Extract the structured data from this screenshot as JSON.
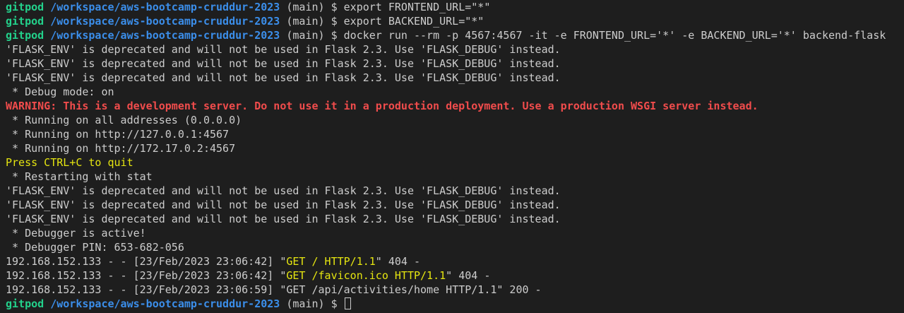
{
  "prompt": {
    "user": "gitpod",
    "path": "/workspace/aws-bootcamp-cruddur-2023",
    "branch": "(main)",
    "symbol": "$"
  },
  "commands": {
    "export_frontend": "export FRONTEND_URL=\"*\"",
    "export_backend": "export BACKEND_URL=\"*\"",
    "docker_run": "docker run --rm -p 4567:4567 -it -e FRONTEND_URL='*' -e BACKEND_URL='*' backend-flask"
  },
  "output": {
    "deprecation": "'FLASK_ENV' is deprecated and will not be used in Flask 2.3. Use 'FLASK_DEBUG' instead.",
    "debug_mode": " * Debug mode: on",
    "warning": "WARNING: This is a development server. Do not use it in a production deployment. Use a production WSGI server instead.",
    "running_all": " * Running on all addresses (0.0.0.0)",
    "running_local": " * Running on http://127.0.0.1:4567",
    "running_docker": " * Running on http://172.17.0.2:4567",
    "quit_hint": "Press CTRL+C to quit",
    "restarting": " * Restarting with stat",
    "debugger_active": " * Debugger is active!",
    "debugger_pin": " * Debugger PIN: 653-682-056"
  },
  "requests": [
    {
      "prefix": "192.168.152.133 - - [23/Feb/2023 23:06:42] ",
      "request": "GET / HTTP/1.1",
      "status": " 404 -",
      "highlight": true
    },
    {
      "prefix": "192.168.152.133 - - [23/Feb/2023 23:06:42] ",
      "request": "GET /favicon.ico HTTP/1.1",
      "status": " 404 -",
      "highlight": true
    },
    {
      "prefix": "192.168.152.133 - - [23/Feb/2023 23:06:59] ",
      "request": "GET /api/activities/home HTTP/1.1",
      "status": " 200 -",
      "highlight": false
    }
  ],
  "colors": {
    "background": "#1e1e1e",
    "text": "#cccccc",
    "user": "#23d18b",
    "path": "#3b8eea",
    "warning": "#f14c4c",
    "highlight": "#e5e510"
  }
}
